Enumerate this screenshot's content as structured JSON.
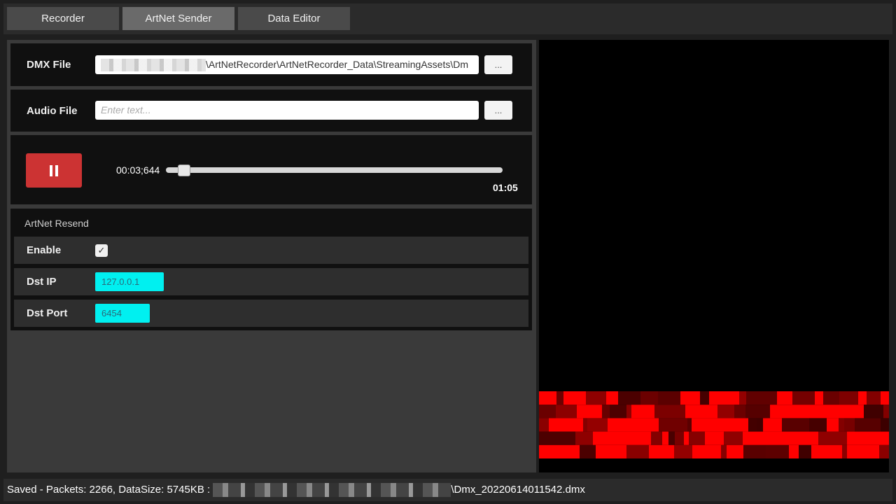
{
  "tabs": [
    {
      "label": "Recorder",
      "active": false
    },
    {
      "label": "ArtNet Sender",
      "active": true
    },
    {
      "label": "Data Editor",
      "active": false
    }
  ],
  "dmx_file": {
    "label": "DMX File",
    "value": "\\ArtNetRecorder\\ArtNetRecorder_Data\\StreamingAssets\\Dm",
    "browse_label": "..."
  },
  "audio_file": {
    "label": "Audio File",
    "placeholder": "Enter text...",
    "browse_label": "..."
  },
  "playback": {
    "button_icon": "pause-icon",
    "current_time": "00:03;644",
    "total_time": "01:05",
    "progress": 0.055
  },
  "resend": {
    "title": "ArtNet Resend",
    "enable_label": "Enable",
    "enabled": true,
    "checkmark": "✓",
    "dst_ip_label": "Dst IP",
    "dst_ip": "127.0.0.1",
    "dst_port_label": "Dst Port",
    "dst_port": "6454"
  },
  "colors": {
    "accent_red": "#cc3333",
    "input_cyan": "#00f0f0",
    "heatmap_red": "#ff0000"
  },
  "status": {
    "prefix": "Saved - Packets: 2266, DataSize: 5745KB : ",
    "suffix": "\\Dmx_20220614011542.dmx"
  }
}
